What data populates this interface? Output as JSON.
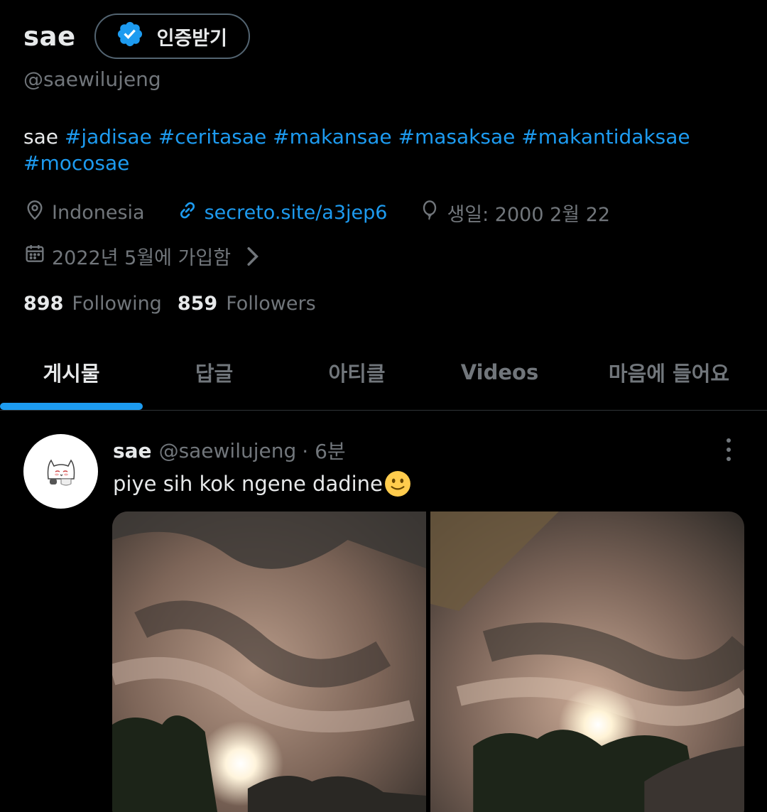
{
  "profile": {
    "display_name": "sae",
    "verify_label": "인증받기",
    "handle": "@saewilujeng",
    "bio": {
      "prefix": "sae ",
      "hashtags": [
        "#jadisae",
        "#ceritasae",
        "#makansae",
        "#masaksae",
        "#makantidaksae",
        "#mocosae"
      ]
    },
    "location": "Indonesia",
    "website": "secreto.site/a3jep6",
    "birthday": "생일: 2000 2월 22",
    "joined": "2022년 5월에 가입함",
    "following_count": "898",
    "following_label": "Following",
    "followers_count": "859",
    "followers_label": "Followers"
  },
  "tabs": [
    {
      "label": "게시물",
      "active": true
    },
    {
      "label": "답글",
      "active": false
    },
    {
      "label": "아티클",
      "active": false
    },
    {
      "label": "Videos",
      "active": false
    },
    {
      "label": "마음에 들어요",
      "active": false
    }
  ],
  "post": {
    "author": "sae",
    "handle": "@saewilujeng",
    "time": "· 6분",
    "text": "piye sih kok ngene dadine",
    "emoji": "slightly-smiling-face-icon",
    "media_count": 2
  },
  "colors": {
    "accent": "#1d9bf0",
    "background": "#000000",
    "muted": "#71767b",
    "text": "#e7e9ea"
  }
}
